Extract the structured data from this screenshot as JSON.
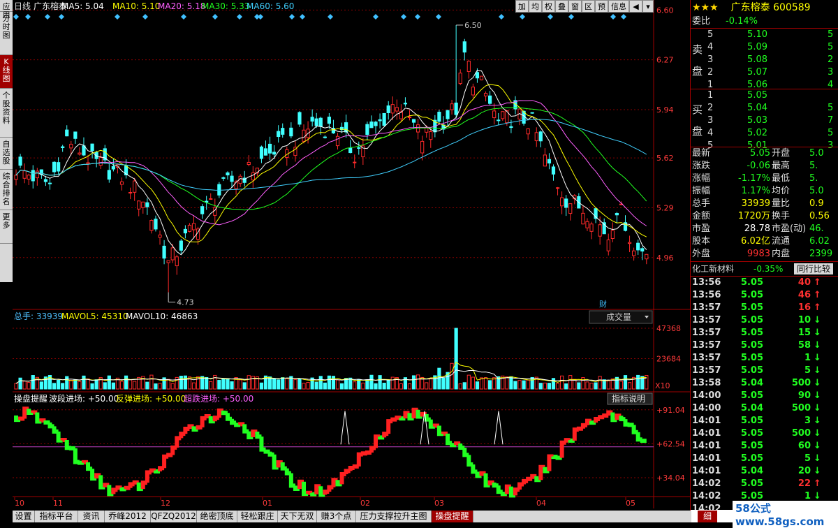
{
  "left_nav": [
    "应用",
    "分时图",
    "K线图",
    "个股资料",
    "自选股",
    "综合排名",
    "更多"
  ],
  "toolbar": [
    "加",
    "均",
    "权",
    "叠",
    "窗",
    "区",
    "预",
    "信息",
    "◀",
    "▾"
  ],
  "header": {
    "period": "日线",
    "name": "广东榕泰",
    "ma5": "MA5: 5.04",
    "ma10": "MA10: 5.10",
    "ma20": "MA20: 5.18",
    "ma30": "MA30: 5.33",
    "ma60": "MA60: 5.60"
  },
  "price_axis": [
    "6.60",
    "6.27",
    "5.94",
    "5.62",
    "5.29",
    "4.96"
  ],
  "price_high_label": "6.50",
  "price_low_label": "4.73",
  "cai_label": "财",
  "volume_header": {
    "total": "总手: 33939",
    "mavol5": "MAVOL5: 45310",
    "mavol10": "MAVOL10: 46863"
  },
  "volume_selector": "成交量",
  "volume_axis": [
    "47368",
    "23684",
    "X10"
  ],
  "indicator_header": {
    "name": "操盘提醒",
    "a": "波段进场: +50.00",
    "b": "反弹进场: +50.00",
    "c": "超跌进场: +50.00"
  },
  "indicator_button": "指标说明",
  "indicator_axis": [
    "+91.04",
    "+62.54",
    "+34.04"
  ],
  "date_axis": [
    "10",
    "11",
    "12",
    "01",
    "02",
    "03",
    "04",
    "05"
  ],
  "bottom_tabs": [
    "设置",
    "指标平台",
    "资讯",
    "乔峰2012",
    "QFZQ2012",
    "绝密顶底",
    "轻松跟庄",
    "天下无双",
    "赚3个点",
    "压力支撑拉升主图",
    "操盘提醒"
  ],
  "quote": {
    "stars": "★★★",
    "title": "广东榕泰 600589",
    "weibi_label": "委比",
    "weibi": "-0.14%",
    "sell_label": [
      "卖",
      "盘"
    ],
    "buy_label": [
      "买",
      "盘"
    ],
    "sells": [
      {
        "lvl": "5",
        "price": "5.10",
        "vol": "5"
      },
      {
        "lvl": "4",
        "price": "5.09",
        "vol": "5"
      },
      {
        "lvl": "3",
        "price": "5.08",
        "vol": "2"
      },
      {
        "lvl": "2",
        "price": "5.07",
        "vol": "3"
      },
      {
        "lvl": "1",
        "price": "5.06",
        "vol": "4"
      }
    ],
    "buys": [
      {
        "lvl": "1",
        "price": "5.05",
        "vol": ""
      },
      {
        "lvl": "2",
        "price": "5.04",
        "vol": "5"
      },
      {
        "lvl": "3",
        "price": "5.03",
        "vol": "7"
      },
      {
        "lvl": "4",
        "price": "5.02",
        "vol": "5"
      },
      {
        "lvl": "5",
        "price": "5.01",
        "vol": "3"
      }
    ],
    "stats": [
      {
        "l": "最新",
        "v": "5.05",
        "l2": "开盘",
        "v2": "5.0"
      },
      {
        "l": "涨跌",
        "v": "-0.06",
        "l2": "最高",
        "v2": "5."
      },
      {
        "l": "涨幅",
        "v": "-1.17%",
        "l2": "最低",
        "v2": "5."
      },
      {
        "l": "振幅",
        "v": "1.17%",
        "l2": "均价",
        "v2": "5.0"
      },
      {
        "l": "总手",
        "v": "33939",
        "l2": "量比",
        "v2": "0.9"
      },
      {
        "l": "金额",
        "v": "1720万",
        "l2": "换手",
        "v2": "0.56"
      },
      {
        "l": "市盈",
        "v": "28.78",
        "l2": "市盈(动)",
        "v2": "46."
      },
      {
        "l": "股本",
        "v": "6.02亿",
        "l2": "流通",
        "v2": "6.02"
      },
      {
        "l": "外盘",
        "v": "9983",
        "l2": "内盘",
        "v2": "2399"
      }
    ],
    "sector": "化工新材料",
    "sector_pct": "-0.35%",
    "sector_btn": "同行比较",
    "ticks": [
      {
        "t": "13:56",
        "p": "5.05",
        "v": "40",
        "d": "up"
      },
      {
        "t": "13:56",
        "p": "5.05",
        "v": "46",
        "d": "up"
      },
      {
        "t": "13:57",
        "p": "5.05",
        "v": "16",
        "d": "up"
      },
      {
        "t": "13:57",
        "p": "5.05",
        "v": "10",
        "d": "down"
      },
      {
        "t": "13:57",
        "p": "5.05",
        "v": "15",
        "d": "down"
      },
      {
        "t": "13:57",
        "p": "5.05",
        "v": "58",
        "d": "down"
      },
      {
        "t": "13:57",
        "p": "5.05",
        "v": "1",
        "d": "down"
      },
      {
        "t": "13:57",
        "p": "5.05",
        "v": "5",
        "d": "down"
      },
      {
        "t": "13:58",
        "p": "5.04",
        "v": "500",
        "d": "down"
      },
      {
        "t": "14:00",
        "p": "5.05",
        "v": "90",
        "d": "down"
      },
      {
        "t": "14:00",
        "p": "5.04",
        "v": "500",
        "d": "down"
      },
      {
        "t": "14:01",
        "p": "5.05",
        "v": "3",
        "d": "down"
      },
      {
        "t": "14:01",
        "p": "5.05",
        "v": "500",
        "d": "down"
      },
      {
        "t": "14:01",
        "p": "5.05",
        "v": "60",
        "d": "down"
      },
      {
        "t": "14:01",
        "p": "5.05",
        "v": "5",
        "d": "down"
      },
      {
        "t": "14:01",
        "p": "5.04",
        "v": "20",
        "d": "down"
      },
      {
        "t": "14:02",
        "p": "5.05",
        "v": "22",
        "d": "up"
      },
      {
        "t": "14:02",
        "p": "5.05",
        "v": "1",
        "d": "down"
      },
      {
        "t": "14:02",
        "p": "",
        "v": "",
        "d": ""
      }
    ],
    "footer_tab": "细",
    "watermark": "58公式 www.58gs.com"
  },
  "colors": {
    "up": "#ff2a2a",
    "down": "#40ffff",
    "grid": "#8b0000",
    "ma5": "#ffffff",
    "ma10": "#ffff00",
    "ma20": "#ff60ff",
    "ma30": "#20ff20",
    "ma60": "#40d0ff"
  }
}
